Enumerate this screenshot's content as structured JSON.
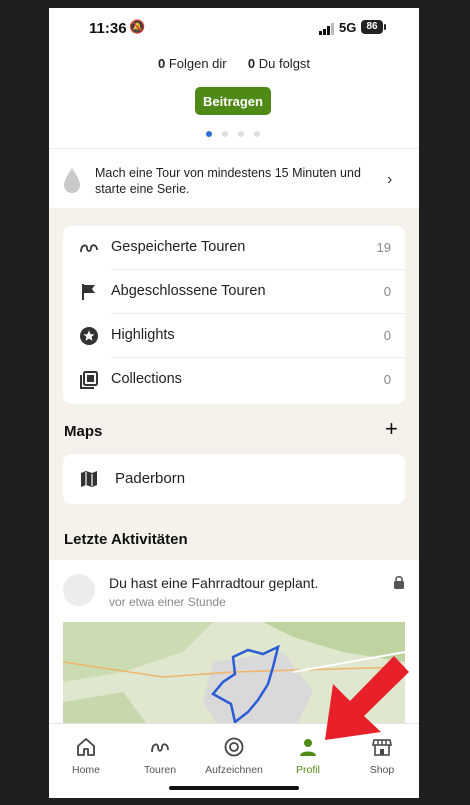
{
  "status_bar": {
    "time": "11:36",
    "network": "5G",
    "battery": "86"
  },
  "profile": {
    "followers_count": "0",
    "followers_label": "Folgen dir",
    "following_count": "0",
    "following_label": "Du folgst",
    "contribute_label": "Beitragen",
    "pager": {
      "pages": 4,
      "active": 0
    }
  },
  "streak": {
    "text": "Mach eine Tour von mindestens 15 Minuten und starte eine Serie."
  },
  "collections_list": [
    {
      "label": "Gespeicherte Touren",
      "count": "19",
      "icon": "route-icon"
    },
    {
      "label": "Abgeschlossene Touren",
      "count": "0",
      "icon": "flag-icon"
    },
    {
      "label": "Highlights",
      "count": "0",
      "icon": "star-badge-icon"
    },
    {
      "label": "Collections",
      "count": "0",
      "icon": "collection-icon"
    }
  ],
  "maps": {
    "title": "Maps",
    "items": [
      {
        "label": "Paderborn",
        "icon": "map-icon"
      }
    ]
  },
  "activities": {
    "title": "Letzte Aktivitäten",
    "items": [
      {
        "title": "Du hast eine Fahrradtour geplant.",
        "time": "vor etwa einer Stunde"
      }
    ]
  },
  "tabbar": {
    "active": "profil",
    "items": [
      {
        "id": "home",
        "label": "Home",
        "icon": "home-icon"
      },
      {
        "id": "touren",
        "label": "Touren",
        "icon": "route-icon"
      },
      {
        "id": "aufzeichnen",
        "label": "Aufzeichnen",
        "icon": "record-icon"
      },
      {
        "id": "profil",
        "label": "Profil",
        "icon": "person-icon"
      },
      {
        "id": "shop",
        "label": "Shop",
        "icon": "shop-icon"
      }
    ]
  },
  "colors": {
    "accent": "#4f8a16",
    "background": "#f4f2ea",
    "annotation_arrow": "#e8202a"
  }
}
